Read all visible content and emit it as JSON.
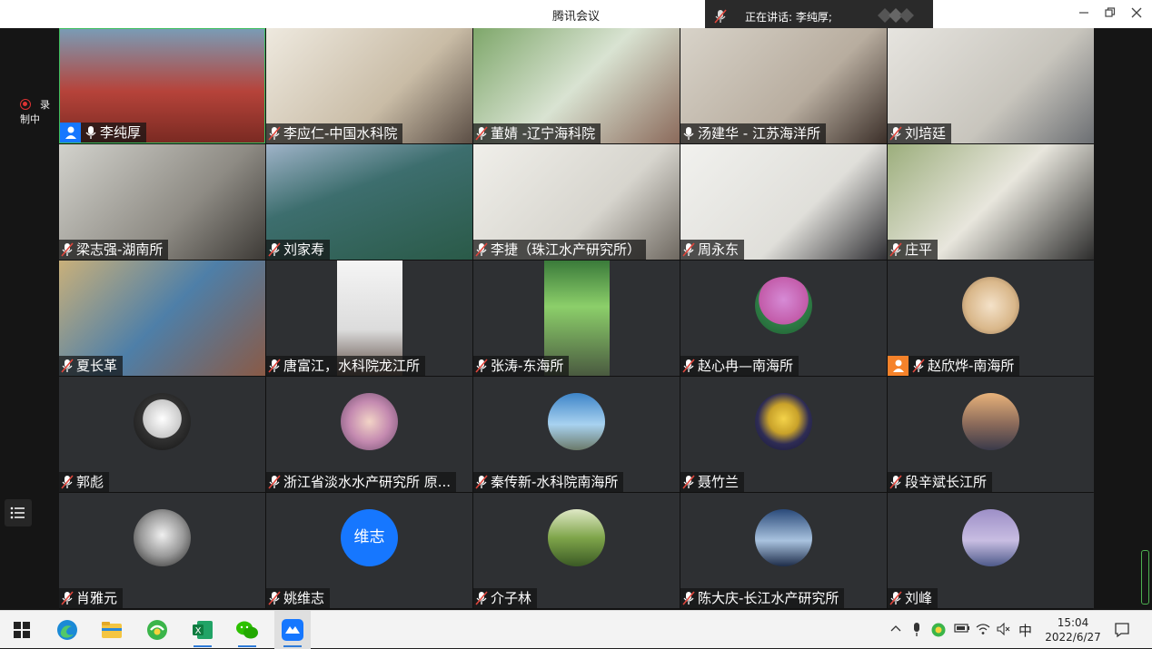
{
  "window": {
    "title": "腾讯会议",
    "controls": [
      "minimize",
      "restore",
      "close"
    ]
  },
  "speaking_banner": {
    "text": "正在讲话: 李纯厚;"
  },
  "recording": {
    "label": "录制中"
  },
  "participants": [
    {
      "name": "李纯厚",
      "mic": "on",
      "host_badge": "blue"
    },
    {
      "name": "李应仁-中国水科院",
      "mic": "muted"
    },
    {
      "name": "董婧 -辽宁海科院",
      "mic": "muted"
    },
    {
      "name": "汤建华 - 江苏海洋所",
      "mic": "on"
    },
    {
      "name": "刘培廷",
      "mic": "muted"
    },
    {
      "name": "梁志强-湖南所",
      "mic": "muted"
    },
    {
      "name": "刘家寿",
      "mic": "muted"
    },
    {
      "name": "李捷（珠江水产研究所）",
      "mic": "muted"
    },
    {
      "name": "周永东",
      "mic": "muted"
    },
    {
      "name": "庄平",
      "mic": "muted"
    },
    {
      "name": "夏长革",
      "mic": "muted"
    },
    {
      "name": "唐富江，水科院龙江所",
      "mic": "muted"
    },
    {
      "name": "张涛-东海所",
      "mic": "muted"
    },
    {
      "name": "赵心冉—南海所",
      "mic": "muted"
    },
    {
      "name": "赵欣烨-南海所",
      "mic": "muted",
      "host_badge": "orange"
    },
    {
      "name": "郭彪",
      "mic": "muted"
    },
    {
      "name": "浙江省淡水水产研究所  原...",
      "mic": "muted"
    },
    {
      "name": "秦传新-水科院南海所",
      "mic": "muted"
    },
    {
      "name": "聂竹兰",
      "mic": "muted"
    },
    {
      "name": "段辛斌长江所",
      "mic": "muted"
    },
    {
      "name": "肖雅元",
      "mic": "muted"
    },
    {
      "name": "姚维志",
      "mic": "muted",
      "avatar_text": "维志"
    },
    {
      "name": "介子林",
      "mic": "muted"
    },
    {
      "name": "陈大庆-长江水产研究所",
      "mic": "muted"
    },
    {
      "name": "刘峰",
      "mic": "muted"
    }
  ],
  "taskbar": {
    "apps": [
      "windows-start",
      "edge",
      "file-explorer",
      "360-browser",
      "excel",
      "wechat",
      "tencent-meeting"
    ],
    "ime": "中",
    "time": "15:04",
    "date": "2022/6/27"
  },
  "colors": {
    "accent_blue": "#1677ff",
    "speaking_border": "#3fbf5e",
    "muted_red": "#e0463c"
  }
}
